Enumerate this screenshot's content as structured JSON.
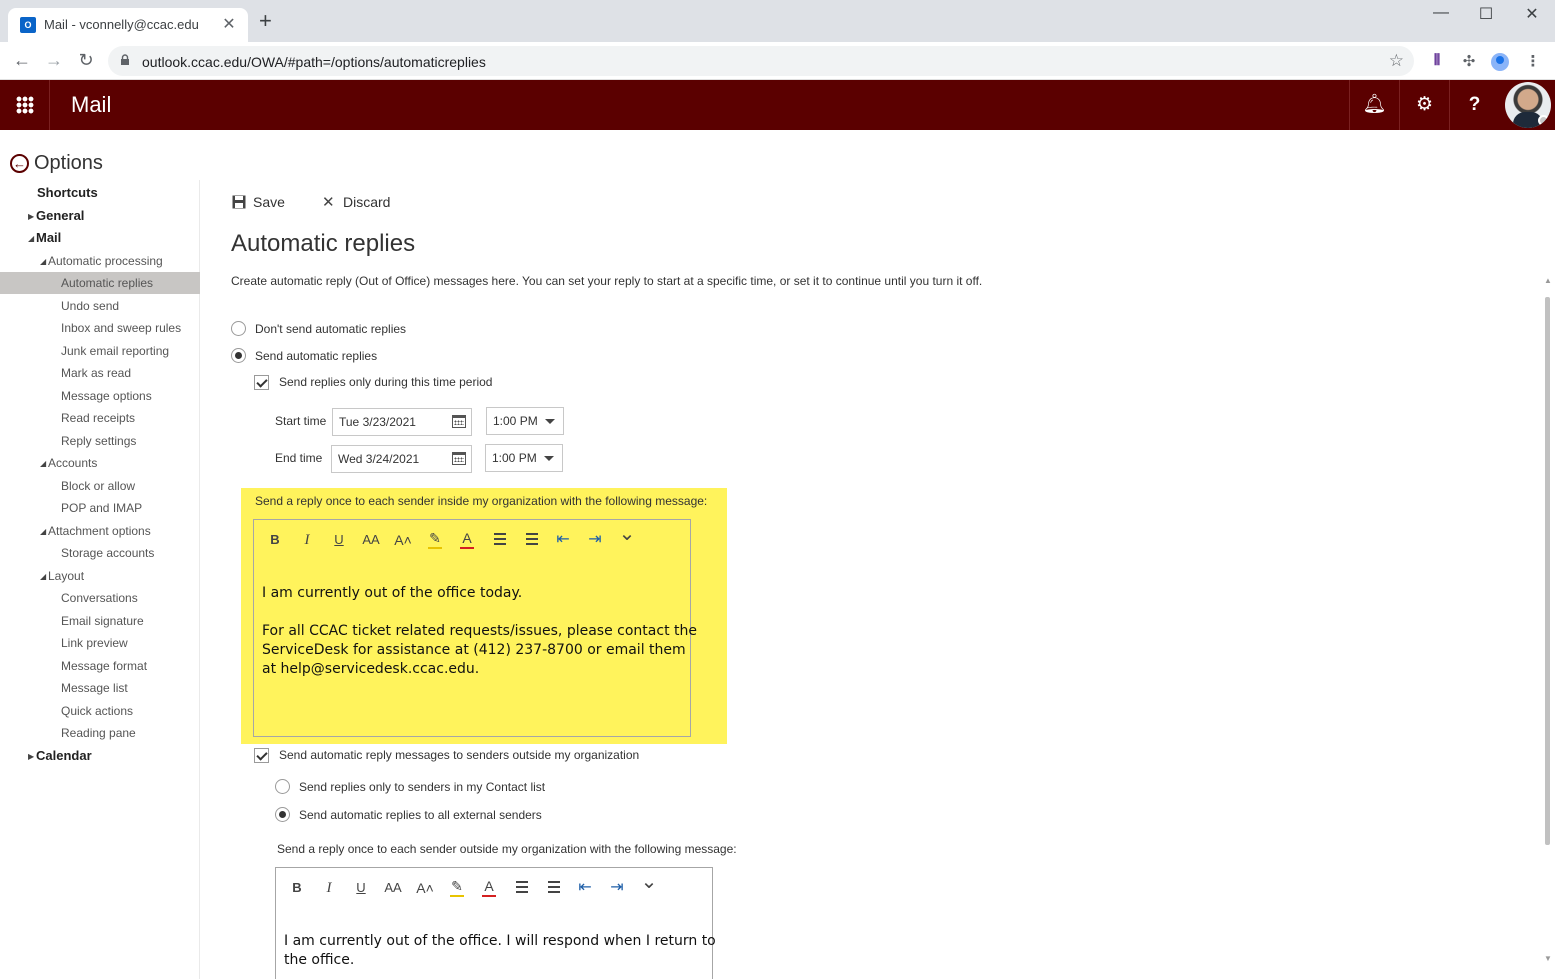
{
  "browser": {
    "tab_title": "Mail - vconnelly@ccac.edu",
    "tab_icon": "outlook-icon",
    "url": "outlook.ccac.edu/OWA/#path=/options/automaticreplies"
  },
  "header": {
    "app_title": "Mail",
    "accent_color": "#5b0000"
  },
  "options": {
    "back_label": "Options"
  },
  "nav": {
    "items": [
      {
        "label": "Shortcuts",
        "level": 0
      },
      {
        "label": "General",
        "level": 0,
        "expandable": true,
        "expanded": false
      },
      {
        "label": "Mail",
        "level": 0,
        "expandable": true,
        "expanded": true
      },
      {
        "label": "Automatic processing",
        "level": 1,
        "expandable": true,
        "expanded": true
      },
      {
        "label": "Automatic replies",
        "level": 2,
        "selected": true
      },
      {
        "label": "Undo send",
        "level": 2
      },
      {
        "label": "Inbox and sweep rules",
        "level": 2
      },
      {
        "label": "Junk email reporting",
        "level": 2
      },
      {
        "label": "Mark as read",
        "level": 2
      },
      {
        "label": "Message options",
        "level": 2
      },
      {
        "label": "Read receipts",
        "level": 2
      },
      {
        "label": "Reply settings",
        "level": 2
      },
      {
        "label": "Accounts",
        "level": 1,
        "expandable": true,
        "expanded": true
      },
      {
        "label": "Block or allow",
        "level": 2
      },
      {
        "label": "POP and IMAP",
        "level": 2
      },
      {
        "label": "Attachment options",
        "level": 1,
        "expandable": true,
        "expanded": true
      },
      {
        "label": "Storage accounts",
        "level": 2
      },
      {
        "label": "Layout",
        "level": 1,
        "expandable": true,
        "expanded": true
      },
      {
        "label": "Conversations",
        "level": 2
      },
      {
        "label": "Email signature",
        "level": 2
      },
      {
        "label": "Link preview",
        "level": 2
      },
      {
        "label": "Message format",
        "level": 2
      },
      {
        "label": "Message list",
        "level": 2
      },
      {
        "label": "Quick actions",
        "level": 2
      },
      {
        "label": "Reading pane",
        "level": 2
      },
      {
        "label": "Calendar",
        "level": 0,
        "expandable": true,
        "expanded": false
      }
    ]
  },
  "commands": {
    "save": "Save",
    "discard": "Discard"
  },
  "page": {
    "title": "Automatic replies",
    "description": "Create automatic reply (Out of Office) messages here. You can set your reply to start at a specific time, or set it to continue until you turn it off."
  },
  "form": {
    "dont_send": "Don't send automatic replies",
    "send": "Send automatic replies",
    "send_selected": true,
    "time_period_label": "Send replies only during this time period",
    "time_period_checked": true,
    "start_label": "Start time",
    "start_date": "Tue 3/23/2021",
    "start_time": "1:00 PM",
    "end_label": "End time",
    "end_date": "Wed 3/24/2021",
    "end_time": "1:00 PM",
    "inside_label": "Send a reply once to each sender inside my organization with the following message:",
    "inside_message": [
      "I am currently out of the office today.",
      "",
      "For all CCAC ticket related requests/issues, please contact the",
      "ServiceDesk for assistance at (412) 237-8700 or email them",
      "at help@servicedesk.ccac.edu."
    ],
    "outside_checkbox": "Send automatic reply messages to senders outside my organization",
    "outside_checked": true,
    "contacts_only": "Send replies only to senders in my Contact list",
    "all_external": "Send automatic replies to all external senders",
    "all_external_selected": true,
    "outside_label": "Send a reply once to each sender outside my organization with the following message:",
    "outside_message": [
      "I am currently out of the office. I will respond when I return to",
      "the office."
    ],
    "highlight_color": "#fff35c"
  },
  "toolbar_icons": [
    "bold-icon",
    "italic-icon",
    "underline-icon",
    "font-size-icon",
    "grow-font-icon",
    "highlight-icon",
    "font-color-icon",
    "bullets-icon",
    "numbering-icon",
    "decrease-indent-icon",
    "increase-indent-icon",
    "more-options-icon"
  ]
}
